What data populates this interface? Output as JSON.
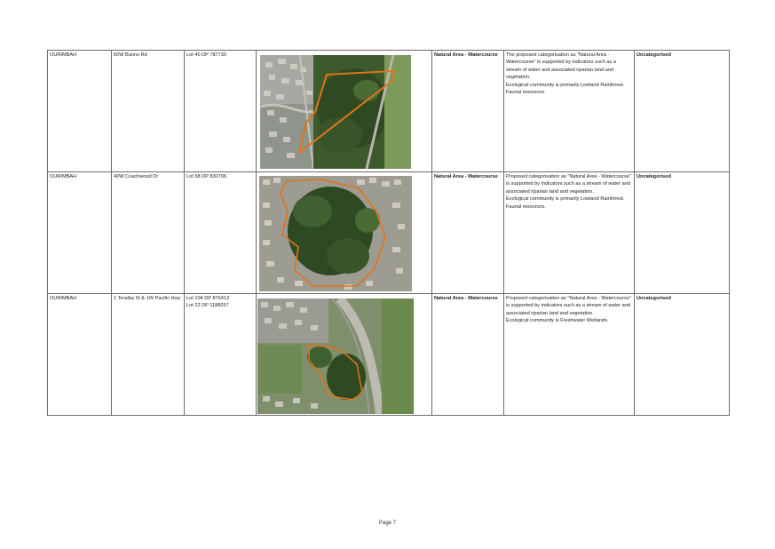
{
  "rows": [
    {
      "suburb": "OURIMBAH",
      "address": "60W Bunns Rd",
      "lots": [
        "Lot 40 DP 787730"
      ],
      "category": "Natural Area - Watercourse",
      "reasons": [
        "The  proposed categorisation as \"Natural Area - Watercourse\" is supported by indicators such as a stream of water and associated riparian land and vegetation.",
        "Ecological community is primarily Lowland Rainforest. Faunal resources."
      ],
      "status": "Uncategorised"
    },
    {
      "suburb": "OURIMBAH",
      "address": "40W Coachwood Dr",
      "lots": [
        "Lot 58 DP 830706"
      ],
      "category": "Natural Area - Watercourse",
      "reasons": [
        "Proposed categorisation as \"Natural Area - Watercourse\" is supported by indicators such as a stream of water and associated riparian land and vegetation.",
        "Ecological community is primarily Lowland Rainforest. Faunal resources."
      ],
      "status": "Uncategorised"
    },
    {
      "suburb": "OURIMBAH",
      "address": "1 Teralba St & 1W Pacific Hwy",
      "lots": [
        "Lot 104 DP 876413",
        "Lot 22 DP 1188257"
      ],
      "category": "Natural Area - Watercourse",
      "reasons": [
        "Proposed categorisation as \"Natural Area - Watercourse\" is supported by indicators such as a stream of water and associated riparian land and vegetation.",
        "Ecological community is Freshwater Wetlands."
      ],
      "status": "Uncategorised"
    }
  ],
  "colors": {
    "boundary": "#e3731c",
    "bush": "#2f4a22",
    "grass": "#7c9a5a",
    "road": "#b9b6ae",
    "roof": "#cfcac2"
  },
  "footer": {
    "page_label": "Page 7"
  }
}
